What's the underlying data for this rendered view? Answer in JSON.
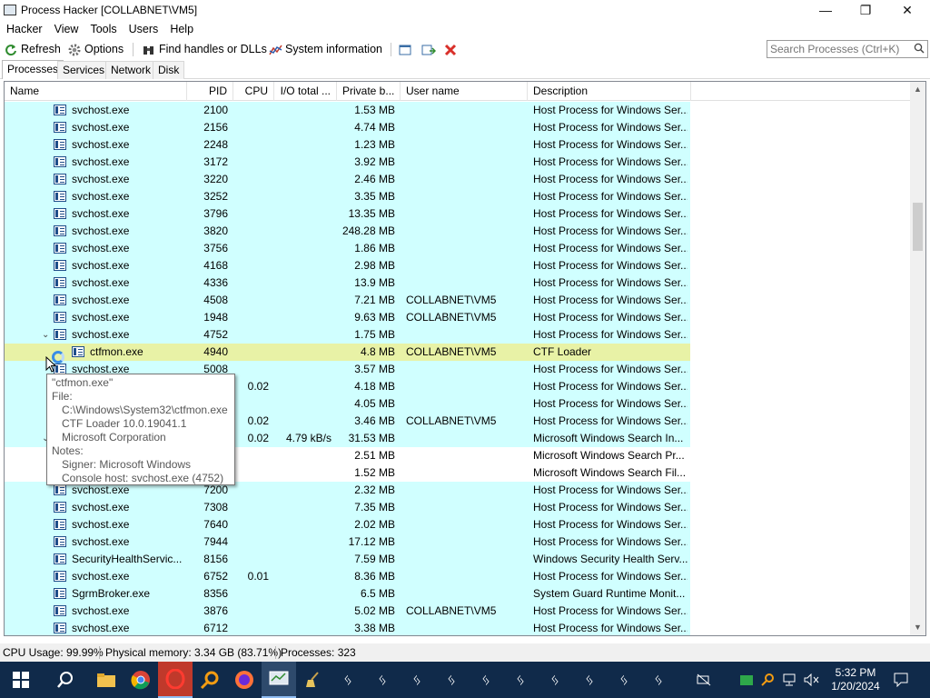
{
  "window": {
    "title": "Process Hacker [COLLABNET\\VM5]"
  },
  "menu": [
    "Hacker",
    "View",
    "Tools",
    "Users",
    "Help"
  ],
  "toolbar": {
    "refresh": "Refresh",
    "options": "Options",
    "find_handles": "Find handles or DLLs",
    "system_info": "System information"
  },
  "search": {
    "placeholder": "Search Processes (Ctrl+K)"
  },
  "tabs": [
    "Processes",
    "Services",
    "Network",
    "Disk"
  ],
  "columns": [
    "Name",
    "PID",
    "CPU",
    "I/O total ...",
    "Private b...",
    "User name",
    "Description"
  ],
  "rows": [
    {
      "name": "svchost.exe",
      "pid": "2100",
      "cpu": "",
      "io": "",
      "priv": "1.53 MB",
      "user": "",
      "desc": "Host Process for Windows Ser..."
    },
    {
      "name": "svchost.exe",
      "pid": "2156",
      "cpu": "",
      "io": "",
      "priv": "4.74 MB",
      "user": "",
      "desc": "Host Process for Windows Ser..."
    },
    {
      "name": "svchost.exe",
      "pid": "2248",
      "cpu": "",
      "io": "",
      "priv": "1.23 MB",
      "user": "",
      "desc": "Host Process for Windows Ser..."
    },
    {
      "name": "svchost.exe",
      "pid": "3172",
      "cpu": "",
      "io": "",
      "priv": "3.92 MB",
      "user": "",
      "desc": "Host Process for Windows Ser..."
    },
    {
      "name": "svchost.exe",
      "pid": "3220",
      "cpu": "",
      "io": "",
      "priv": "2.46 MB",
      "user": "",
      "desc": "Host Process for Windows Ser..."
    },
    {
      "name": "svchost.exe",
      "pid": "3252",
      "cpu": "",
      "io": "",
      "priv": "3.35 MB",
      "user": "",
      "desc": "Host Process for Windows Ser..."
    },
    {
      "name": "svchost.exe",
      "pid": "3796",
      "cpu": "",
      "io": "",
      "priv": "13.35 MB",
      "user": "",
      "desc": "Host Process for Windows Ser..."
    },
    {
      "name": "svchost.exe",
      "pid": "3820",
      "cpu": "",
      "io": "",
      "priv": "248.28 MB",
      "user": "",
      "desc": "Host Process for Windows Ser..."
    },
    {
      "name": "svchost.exe",
      "pid": "3756",
      "cpu": "",
      "io": "",
      "priv": "1.86 MB",
      "user": "",
      "desc": "Host Process for Windows Ser..."
    },
    {
      "name": "svchost.exe",
      "pid": "4168",
      "cpu": "",
      "io": "",
      "priv": "2.98 MB",
      "user": "",
      "desc": "Host Process for Windows Ser..."
    },
    {
      "name": "svchost.exe",
      "pid": "4336",
      "cpu": "",
      "io": "",
      "priv": "13.9 MB",
      "user": "",
      "desc": "Host Process for Windows Ser..."
    },
    {
      "name": "svchost.exe",
      "pid": "4508",
      "cpu": "",
      "io": "",
      "priv": "7.21 MB",
      "user": "COLLABNET\\VM5",
      "desc": "Host Process for Windows Ser..."
    },
    {
      "name": "svchost.exe",
      "pid": "1948",
      "cpu": "",
      "io": "",
      "priv": "9.63 MB",
      "user": "COLLABNET\\VM5",
      "desc": "Host Process for Windows Ser..."
    },
    {
      "name": "svchost.exe",
      "pid": "4752",
      "cpu": "",
      "io": "",
      "priv": "1.75 MB",
      "user": "",
      "desc": "Host Process for Windows Ser...",
      "expanded": true
    },
    {
      "name": "ctfmon.exe",
      "pid": "4940",
      "cpu": "",
      "io": "",
      "priv": "4.8 MB",
      "user": "COLLABNET\\VM5",
      "desc": "CTF Loader",
      "child": true,
      "highlight": true
    },
    {
      "name": "svchost.exe",
      "pid": "5008",
      "cpu": "",
      "io": "",
      "priv": "3.57 MB",
      "user": "",
      "desc": "Host Process for Windows Ser..."
    },
    {
      "name": "",
      "pid": "",
      "cpu": "0.02",
      "io": "",
      "priv": "4.18 MB",
      "user": "",
      "desc": "Host Process for Windows Ser..."
    },
    {
      "name": "",
      "pid": "",
      "cpu": "",
      "io": "",
      "priv": "4.05 MB",
      "user": "",
      "desc": "Host Process for Windows Ser..."
    },
    {
      "name": "",
      "pid": "",
      "cpu": "0.02",
      "io": "",
      "priv": "3.46 MB",
      "user": "COLLABNET\\VM5",
      "desc": "Host Process for Windows Ser..."
    },
    {
      "name": "",
      "pid": "",
      "cpu": "0.02",
      "io": "4.79 kB/s",
      "priv": "31.53 MB",
      "user": "",
      "desc": "Microsoft Windows Search In...",
      "expanded": true
    },
    {
      "name": "",
      "pid": "",
      "cpu": "",
      "io": "",
      "priv": "2.51 MB",
      "user": "",
      "desc": "Microsoft Windows Search Pr...",
      "white": true
    },
    {
      "name": "",
      "pid": "",
      "cpu": "",
      "io": "",
      "priv": "1.52 MB",
      "user": "",
      "desc": "Microsoft Windows Search Fil...",
      "white": true
    },
    {
      "name": "svchost.exe",
      "pid": "7200",
      "cpu": "",
      "io": "",
      "priv": "2.32 MB",
      "user": "",
      "desc": "Host Process for Windows Ser..."
    },
    {
      "name": "svchost.exe",
      "pid": "7308",
      "cpu": "",
      "io": "",
      "priv": "7.35 MB",
      "user": "",
      "desc": "Host Process for Windows Ser..."
    },
    {
      "name": "svchost.exe",
      "pid": "7640",
      "cpu": "",
      "io": "",
      "priv": "2.02 MB",
      "user": "",
      "desc": "Host Process for Windows Ser..."
    },
    {
      "name": "svchost.exe",
      "pid": "7944",
      "cpu": "",
      "io": "",
      "priv": "17.12 MB",
      "user": "",
      "desc": "Host Process for Windows Ser..."
    },
    {
      "name": "SecurityHealthServic...",
      "pid": "8156",
      "cpu": "",
      "io": "",
      "priv": "7.59 MB",
      "user": "",
      "desc": "Windows Security Health Serv..."
    },
    {
      "name": "svchost.exe",
      "pid": "6752",
      "cpu": "0.01",
      "io": "",
      "priv": "8.36 MB",
      "user": "",
      "desc": "Host Process for Windows Ser..."
    },
    {
      "name": "SgrmBroker.exe",
      "pid": "8356",
      "cpu": "",
      "io": "",
      "priv": "6.5 MB",
      "user": "",
      "desc": "System Guard Runtime Monit..."
    },
    {
      "name": "svchost.exe",
      "pid": "3876",
      "cpu": "",
      "io": "",
      "priv": "5.02 MB",
      "user": "COLLABNET\\VM5",
      "desc": "Host Process for Windows Ser..."
    },
    {
      "name": "svchost.exe",
      "pid": "6712",
      "cpu": "",
      "io": "",
      "priv": "3.38 MB",
      "user": "",
      "desc": "Host Process for Windows Ser..."
    }
  ],
  "tooltip": {
    "title": "\"ctfmon.exe\"",
    "file_label": "File:",
    "path": "C:\\Windows\\System32\\ctfmon.exe",
    "version": "CTF Loader 10.0.19041.1",
    "company": "Microsoft Corporation",
    "notes_label": "Notes:",
    "signer": "Signer: Microsoft Windows",
    "console_host": "Console host: svchost.exe (4752)"
  },
  "status": {
    "cpu": "CPU Usage: 99.99%",
    "memory": "Physical memory: 3.34 GB (83.71%)",
    "processes": "Processes: 323"
  },
  "clock": {
    "time": "5:32 PM",
    "date": "1/20/2024"
  },
  "colors": {
    "service_row": "#d0ffff",
    "highlight_row": "#e8f2a6",
    "taskbar": "#102a4a"
  }
}
